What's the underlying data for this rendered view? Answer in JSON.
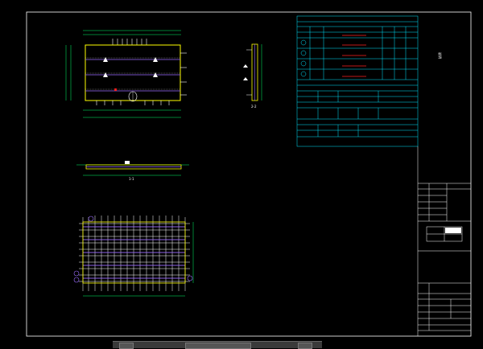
{
  "colors": {
    "background": "#000000",
    "frame": "#ffffff",
    "table": "#00e5ff",
    "rebar_yellow": "#ffff00",
    "rebar_white": "#ffffff",
    "rebar_purple": "#9b6cff",
    "accent_red": "#ff2020",
    "dimension_green": "#00ff66"
  },
  "labels": {
    "section_mark_1": "1-1",
    "section_mark_2": "2-2",
    "vertical_note": "说明"
  },
  "icons": [
    "section-mark-icon",
    "triangle-marker-icon",
    "bubble-tag-icon"
  ],
  "status_bar": {
    "visible": true
  }
}
